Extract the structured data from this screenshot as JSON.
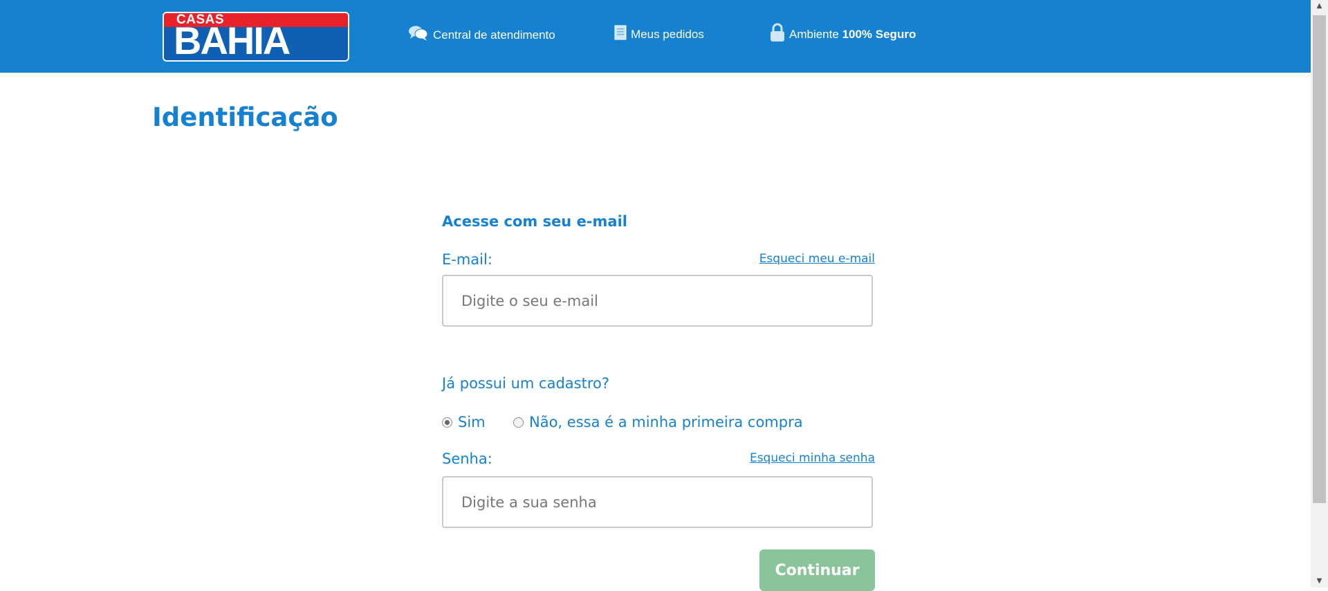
{
  "header": {
    "logo": {
      "top_text": "CASAS",
      "main_text": "BAHIA"
    },
    "nav": [
      {
        "icon": "chat-bubbles-icon",
        "label": "Central de atendimento"
      },
      {
        "icon": "document-icon",
        "label": "Meus pedidos"
      },
      {
        "icon": "lock-icon",
        "label_prefix": "Ambiente",
        "label_strong": "100% Seguro"
      }
    ]
  },
  "page": {
    "title": "Identificação"
  },
  "login": {
    "section_title": "Acesse com seu e-mail",
    "email_label": "E-mail:",
    "email_forgot": "Esqueci meu e-mail",
    "email_value": "",
    "email_placeholder": "Digite o seu e-mail",
    "question": "Já possui um cadastro?",
    "options": [
      {
        "label": "Sim",
        "selected": true
      },
      {
        "label": "Não, essa é a minha primeira compra",
        "selected": false
      }
    ],
    "password_label": "Senha:",
    "password_forgot": "Esqueci minha senha",
    "password_value": "",
    "password_placeholder": "Digite a sua senha",
    "submit_label": "Continuar"
  },
  "colors": {
    "brand_blue": "#1581d0",
    "logo_red": "#e8222a",
    "logo_blue": "#0f5fb5",
    "button_green": "#89c49a"
  }
}
